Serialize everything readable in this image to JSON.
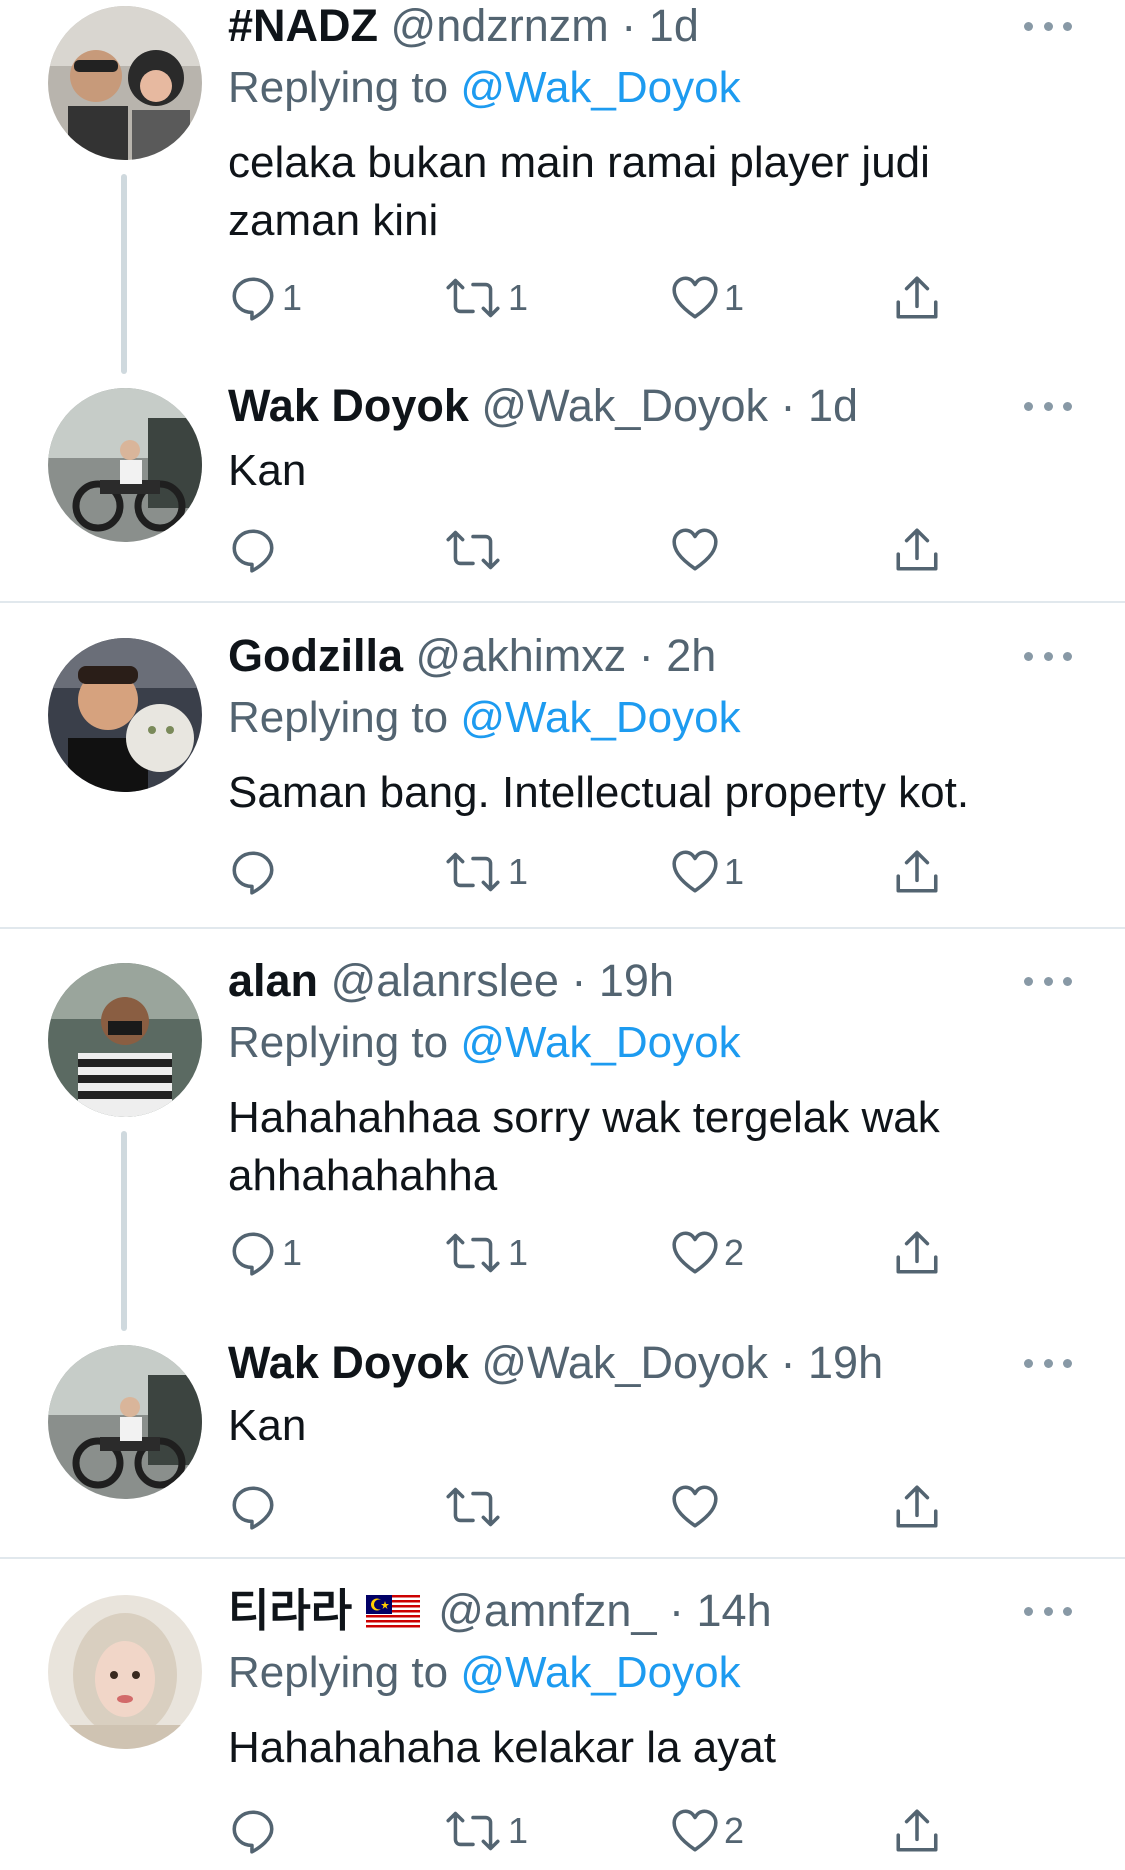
{
  "colors": {
    "text": "#0f1419",
    "secondary": "#536471",
    "link": "#1d9bf0",
    "divider": "#e1e8ed",
    "thread_line": "#cfd9de",
    "icon": "#536471"
  },
  "reply_prefix": "Replying to",
  "tweets": [
    {
      "name": "#NADZ",
      "handle": "@ndzrnzm",
      "dot": "·",
      "time": "1d",
      "replying_to": "@Wak_Doyok",
      "text": "celaka bukan main ramai player judi zaman kini",
      "counts": {
        "reply": "1",
        "retweet": "1",
        "like": "1"
      }
    },
    {
      "name": "Wak Doyok",
      "handle": "@Wak_Doyok",
      "dot": "·",
      "time": "1d",
      "text": "Kan",
      "counts": {
        "reply": "",
        "retweet": "",
        "like": ""
      }
    },
    {
      "name": "Godzilla",
      "handle": "@akhimxz",
      "dot": "·",
      "time": "2h",
      "replying_to": "@Wak_Doyok",
      "text": "Saman bang. Intellectual property kot.",
      "counts": {
        "reply": "",
        "retweet": "1",
        "like": "1"
      }
    },
    {
      "name": "alan",
      "handle": "@alanrslee",
      "dot": "·",
      "time": "19h",
      "replying_to": "@Wak_Doyok",
      "text": "Hahahahhaa sorry wak tergelak wak ahhahahahha",
      "counts": {
        "reply": "1",
        "retweet": "1",
        "like": "2"
      }
    },
    {
      "name": "Wak Doyok",
      "handle": "@Wak_Doyok",
      "dot": "·",
      "time": "19h",
      "text": "Kan",
      "counts": {
        "reply": "",
        "retweet": "",
        "like": ""
      }
    },
    {
      "name": "티라라",
      "flag": "malaysia-flag",
      "handle": "@amnfzn_",
      "dot": "·",
      "time": "14h",
      "replying_to": "@Wak_Doyok",
      "text": "Hahahahaha kelakar la ayat",
      "counts": {
        "reply": "",
        "retweet": "1",
        "like": "2"
      }
    }
  ]
}
